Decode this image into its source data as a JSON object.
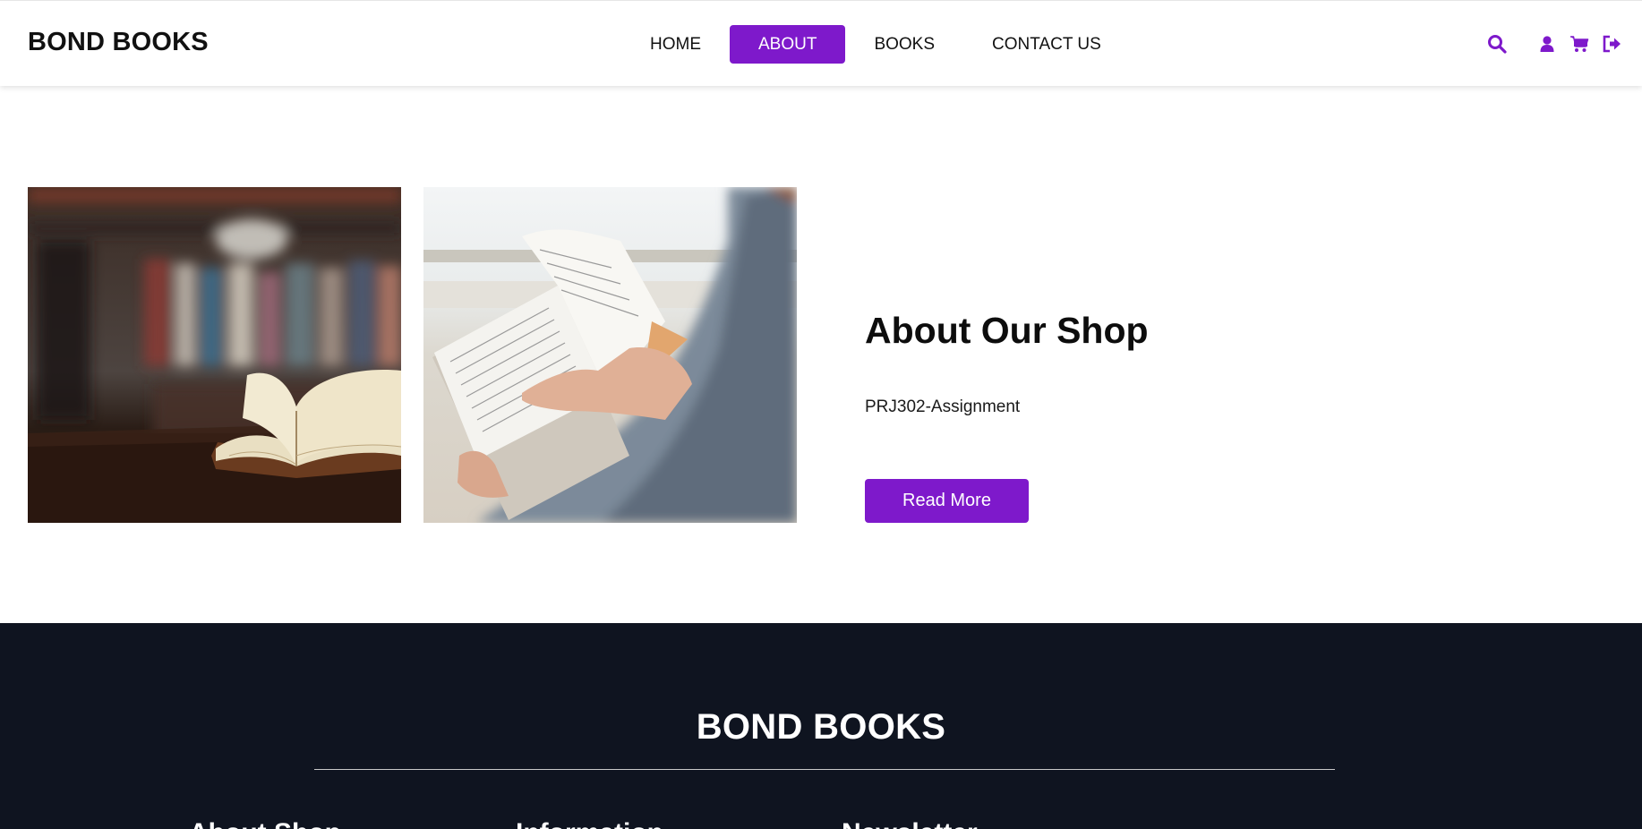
{
  "header": {
    "brand": "BOND BOOKS",
    "nav": [
      {
        "label": "HOME",
        "active": false
      },
      {
        "label": "ABOUT",
        "active": true
      },
      {
        "label": "BOOKS",
        "active": false
      },
      {
        "label": "CONTACT US",
        "active": false
      }
    ],
    "icons": [
      "search-icon",
      "user-icon",
      "cart-icon",
      "logout-icon"
    ]
  },
  "about": {
    "title": "About Our Shop",
    "text": "PRJ302-Assignment",
    "button_label": "Read More"
  },
  "footer": {
    "brand": "BOND BOOKS",
    "columns": [
      "About Shop",
      "Information",
      "Newsletter"
    ]
  },
  "colors": {
    "accent": "#7e19cb",
    "footer_bg": "#0f1420"
  }
}
